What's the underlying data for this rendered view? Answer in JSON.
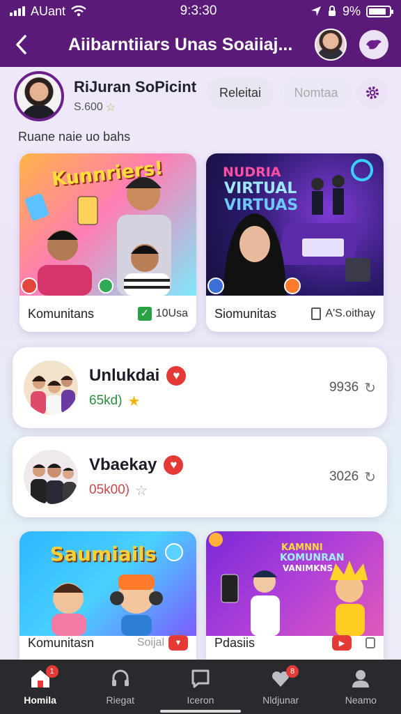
{
  "status_bar": {
    "carrier": "AUant",
    "time": "9:3:30",
    "battery": "9%"
  },
  "header": {
    "title": "Aiibarntiiars Unas Soaiiaj..."
  },
  "profile": {
    "name": "RiJuran SoPicint",
    "sub": "S.600"
  },
  "chips": {
    "first": "Releitai",
    "second": "Nomtaa"
  },
  "section_caption": "Ruane naie uo bahs",
  "featured": [
    {
      "img_title": "Kunnriers!",
      "label": "Komunitans",
      "meta": "10Usa"
    },
    {
      "img_title_1": "NUDRIA",
      "img_title_2": "VIRTUAL",
      "img_title_3": "VIRTUAS",
      "label": "Siomunitas",
      "meta": "A'S.oithay"
    }
  ],
  "groups": [
    {
      "title": "Unlukdai",
      "sub": "65kd)",
      "count": "9936",
      "sub_color": "#2e8b3d"
    },
    {
      "title": "Vbaekay",
      "sub": "05k00)",
      "count": "3026",
      "sub_color": "#c94a4a"
    }
  ],
  "bottom_cards": [
    {
      "img_title": "Saumiails",
      "label": "Komunitasn",
      "meta": "Soijal"
    },
    {
      "img_title_1": "KAMNNI",
      "img_title_2": "KOMUNRAN",
      "img_title_3": "VANIMKNS",
      "label": "Pdasiis",
      "meta": ""
    }
  ],
  "nav": [
    {
      "label": "Homila",
      "icon": "home-icon",
      "badge": "1"
    },
    {
      "label": "Riegat",
      "icon": "headset-icon",
      "badge": ""
    },
    {
      "label": "Iceron",
      "icon": "chat-icon",
      "badge": ""
    },
    {
      "label": "Nldjunar",
      "icon": "heart-icon",
      "badge": "8"
    },
    {
      "label": "Neamo",
      "icon": "person-icon",
      "badge": ""
    }
  ],
  "colors": {
    "brand": "#5a1a78",
    "accent": "#6b1f8a",
    "nav_bg": "#2a2a2e"
  }
}
